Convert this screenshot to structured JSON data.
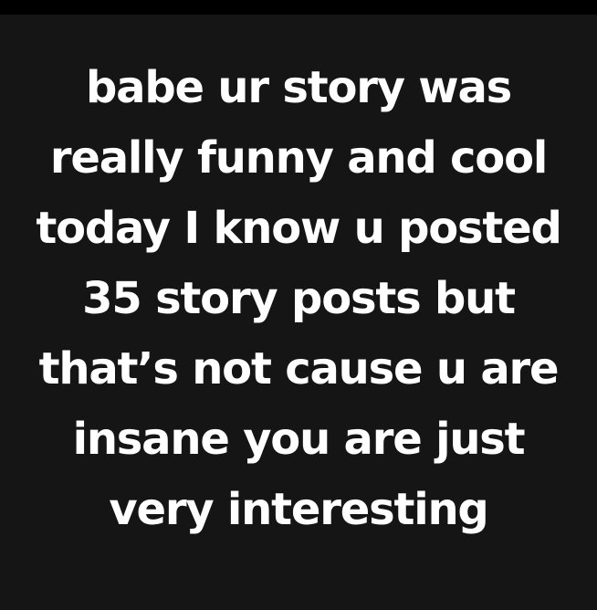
{
  "meme": {
    "lines": [
      "babe ur story was",
      "really funny and cool",
      "today I know u posted",
      "35 story posts but",
      "that’s not cause u are",
      "insane you are just",
      "very interesting"
    ]
  },
  "colors": {
    "background": "#151515",
    "top_bar": "#000000",
    "text": "#ffffff"
  }
}
